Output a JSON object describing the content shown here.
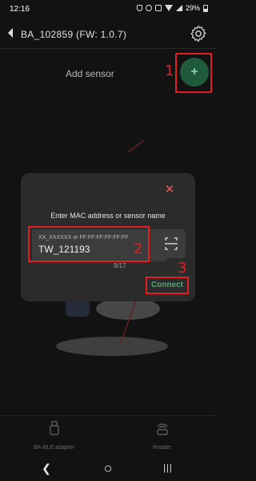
{
  "status_bar": {
    "time": "12:16",
    "battery": "29%"
  },
  "header": {
    "title": "BA_102859 (FW: 1.0.7)"
  },
  "add_sensor": {
    "label": "Add sensor",
    "fab_symbol": "+"
  },
  "dialog": {
    "title": "Enter MAC address or sensor name",
    "close_symbol": "✕",
    "input": {
      "placeholder": "XX_XXXXXX or FF:FF:FF:FF:FF:FF",
      "value": "TW_121193"
    },
    "char_count": "9/17",
    "connect_label": "Connect"
  },
  "markers": [
    "1",
    "2",
    "3"
  ],
  "bottom_nav": {
    "items": [
      {
        "label": "BA-BLE adapter",
        "icon": "usb-adapter-icon"
      },
      {
        "label": "Reader",
        "icon": "reader-icon"
      }
    ]
  },
  "system_nav": {
    "back": "❮",
    "home": "○",
    "recents": "|||"
  },
  "colors": {
    "background": "#121212",
    "dialog": "#2b2b2b",
    "accent_green": "#49b06e",
    "fab_green": "#1f5a3c",
    "marker_red": "#e02020",
    "close_red": "#e35a5a"
  }
}
